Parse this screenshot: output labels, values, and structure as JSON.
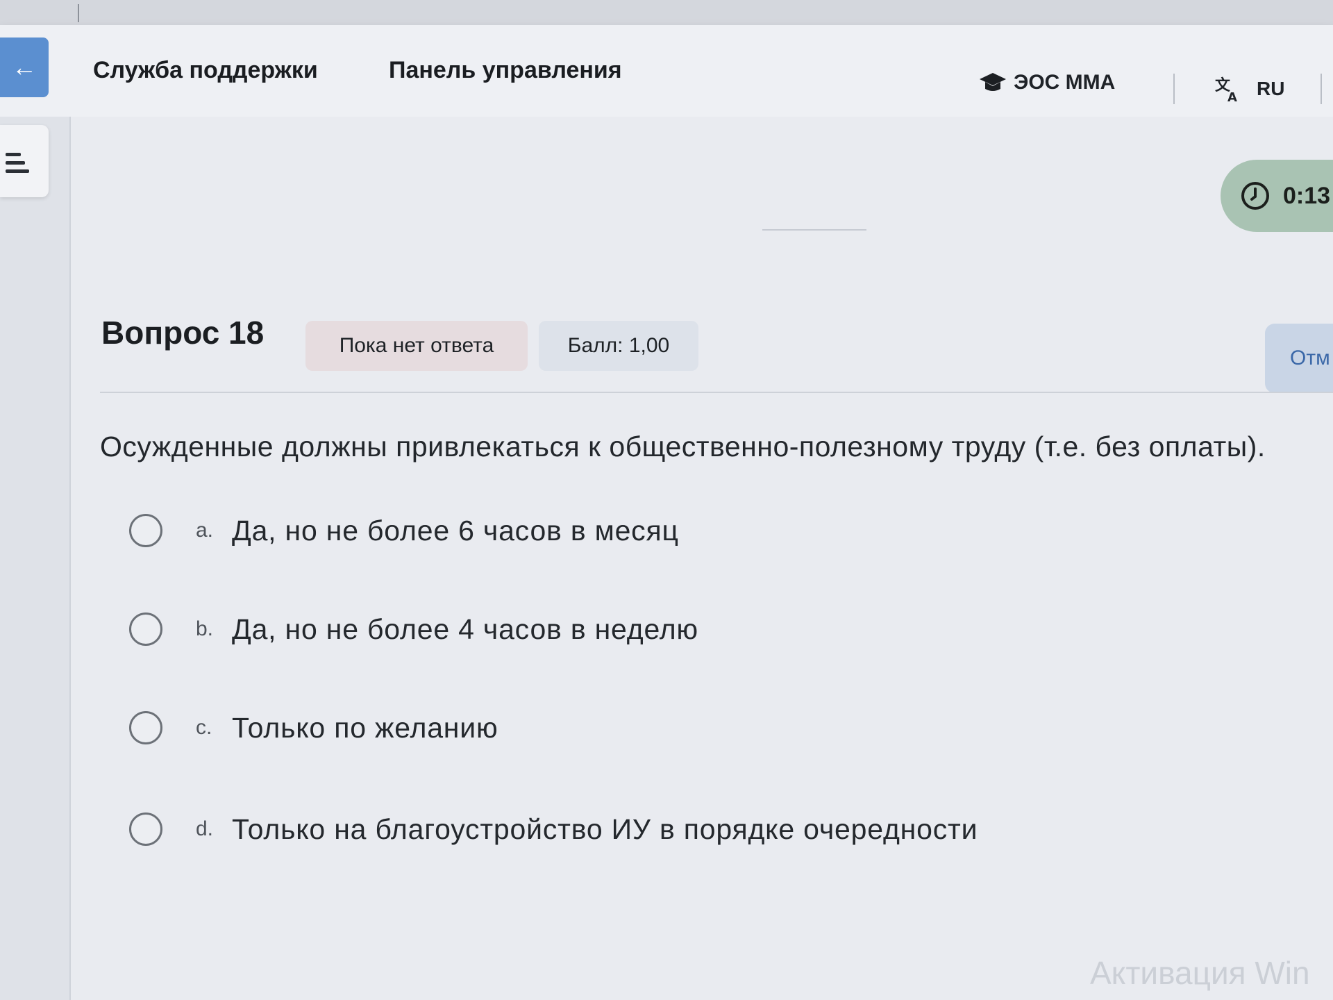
{
  "navbar": {
    "back_icon": "arrow-left-icon",
    "support_label": "Служба поддержки",
    "dashboard_label": "Панель управления",
    "site_icon": "graduation-cap-icon",
    "site_label": "ЭОС ММА",
    "language_icon": "translate-icon",
    "language_label": "RU"
  },
  "sidebar": {
    "toggle_icon": "drawer-toggle-icon"
  },
  "timer": {
    "icon": "clock-icon",
    "value": "0:13"
  },
  "question": {
    "title": "Вопрос 18",
    "status": "Пока нет ответа",
    "score": "Балл: 1,00",
    "flag_label": "Отм",
    "text": "Осужденные должны привлекаться к общественно-полезному труду (т.е. без оплаты).",
    "answers": [
      {
        "letter": "a.",
        "text": "Да, но не более 6 часов в месяц",
        "selected": false
      },
      {
        "letter": "b.",
        "text": "Да, но не более 4 часов в неделю",
        "selected": false
      },
      {
        "letter": "c.",
        "text": "Только по желанию",
        "selected": false
      },
      {
        "letter": "d.",
        "text": "Только на благоустройство ИУ в порядке очередности",
        "selected": false
      }
    ]
  },
  "overlay": {
    "activation_watermark": "Активация Win"
  },
  "colors": {
    "accent": "#5b8fd0",
    "timer_bg": "#a9c3b3",
    "status_badge_bg": "#e6dcdf",
    "score_badge_bg": "#dde2ea"
  }
}
